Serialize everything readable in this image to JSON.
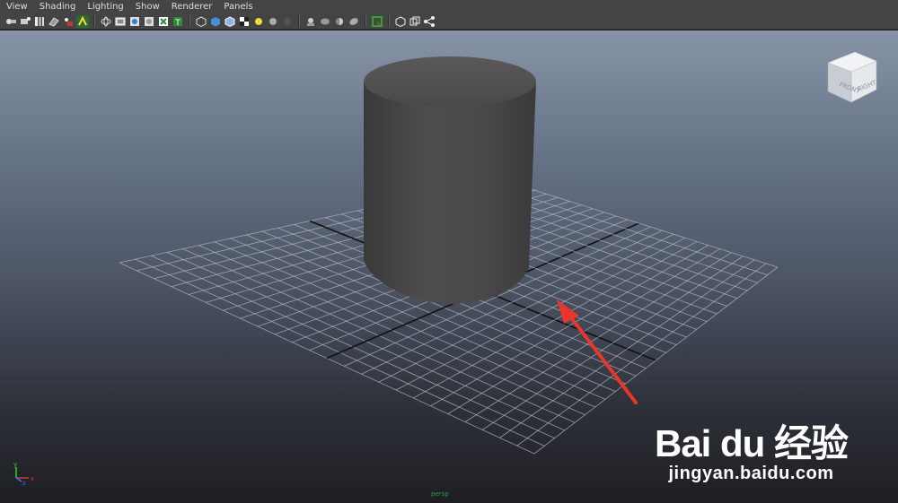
{
  "menubar": {
    "items": [
      {
        "label": "View"
      },
      {
        "label": "Shading"
      },
      {
        "label": "Lighting"
      },
      {
        "label": "Show"
      },
      {
        "label": "Renderer"
      },
      {
        "label": "Panels"
      }
    ]
  },
  "toolbar": {
    "icons": [
      "camera-select-icon",
      "camera-attributes-icon",
      "bookmark-icon",
      "image-plane-icon",
      "grease-pencil-icon",
      "2d-pan-zoom-icon",
      "wireframe-icon",
      "smooth-shade-icon",
      "bounding-box-icon",
      "shadows-icon",
      "xray-icon",
      "textured-icon",
      "cube-wire-icon",
      "cube-shaded-icon",
      "cube-textured-icon",
      "checker-icon",
      "default-light-icon",
      "sphere-shaded-icon",
      "sphere-dark-icon",
      "isolate-icon",
      "hud-icon",
      "gate-icon",
      "resolution-icon",
      "select-camera-icon",
      "frame-all-icon",
      "frame-selected-icon",
      "share-icon"
    ]
  },
  "viewcube": {
    "front_label": "FRONT",
    "right_label": "RIGHT"
  },
  "hud": {
    "camera_label": "persp"
  },
  "axis": {
    "x_label": "x",
    "y_label": "y",
    "z_label": "z"
  },
  "watermark": {
    "logo_text": "Bai du 经验",
    "url": "jingyan.baidu.com"
  },
  "colors": {
    "viewport_top": "#8794a8",
    "viewport_bottom": "#1e1f23",
    "grid_line": "#b8bcc6",
    "grid_axis": "#111111",
    "cylinder": "#4b494a",
    "arrow": "#e8362d"
  }
}
